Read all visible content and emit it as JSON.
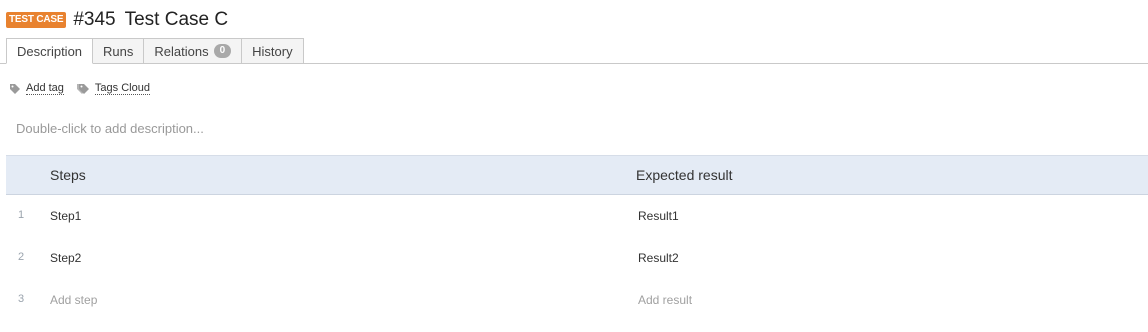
{
  "entity": {
    "type_badge": "TEST CASE",
    "badge_color": "#e8822f",
    "id": "#345",
    "title": "Test Case C"
  },
  "tabs": [
    {
      "label": "Description",
      "active": true
    },
    {
      "label": "Runs",
      "active": false
    },
    {
      "label": "Relations",
      "count": "0",
      "active": false
    },
    {
      "label": "History",
      "active": false
    }
  ],
  "tags": {
    "add_tag": "Add tag",
    "tags_cloud": "Tags Cloud",
    "add_tag_icon": "tag-icon",
    "tags_cloud_icon": "tags-icon"
  },
  "description": {
    "placeholder": "Double-click to add description..."
  },
  "steps_table": {
    "header_steps": "Steps",
    "header_expected": "Expected result",
    "header_bg": "#e4ebf5",
    "rows": [
      {
        "num": "1",
        "step": "Step1",
        "result": "Result1"
      },
      {
        "num": "2",
        "step": "Step2",
        "result": "Result2"
      }
    ],
    "add_row": {
      "num": "3",
      "step": "Add step",
      "result": "Add result"
    }
  }
}
